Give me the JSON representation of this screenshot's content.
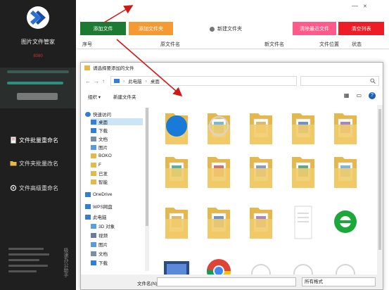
{
  "app": {
    "title": "图片文件管家",
    "subtitle": "8080"
  },
  "sidebar": {
    "items": [
      {
        "label": "文件批量重命名"
      },
      {
        "label": "文件夹批量改名"
      },
      {
        "label": "文件高级重命名"
      }
    ],
    "footer_text": "极速办公助手"
  },
  "window_controls": {
    "minimize": "—",
    "close": "✕"
  },
  "toolbar": {
    "add_file": "添加文件",
    "add_folder": "添加文件夹",
    "new_folder": "新建文件夹",
    "clear_recent": "清除最近文件",
    "clear_list": "清空列表",
    "accent_add": "#1d7a32",
    "accent_folder": "#f59a32",
    "accent_clear_recent": "#ff5a8a",
    "accent_clear": "#ee1c24"
  },
  "table": {
    "columns": [
      "序号",
      "原文件名",
      "新文件名",
      "文件位置",
      "状态"
    ]
  },
  "dialog": {
    "title": "请选择要添加的文件",
    "breadcrumb": [
      "此电脑",
      "桌面"
    ],
    "search_icon": "search-icon",
    "organize": "组织 ▾",
    "new_folder": "新建文件夹",
    "help": "?",
    "tree": [
      {
        "label": "快速访问",
        "icon": "star-icon"
      },
      {
        "label": "桌面",
        "icon": "desktop-icon",
        "selected": true
      },
      {
        "label": "下载",
        "icon": "download-icon"
      },
      {
        "label": "文档",
        "icon": "document-icon"
      },
      {
        "label": "图片",
        "icon": "picture-icon"
      },
      {
        "label": "BOKO",
        "icon": "folder-icon"
      },
      {
        "label": "F",
        "icon": "folder-icon"
      },
      {
        "label": "已发",
        "icon": "folder-icon"
      },
      {
        "label": "智能",
        "icon": "folder-icon"
      },
      {
        "label": "OneDrive",
        "icon": "cloud-icon"
      },
      {
        "label": "WPS网盘",
        "icon": "cloud-icon"
      },
      {
        "label": "此电脑",
        "icon": "computer-icon"
      },
      {
        "label": "3D 对象",
        "icon": "cube-icon"
      },
      {
        "label": "视频",
        "icon": "video-icon"
      },
      {
        "label": "图片",
        "icon": "picture-icon"
      },
      {
        "label": "文档",
        "icon": "document-icon"
      },
      {
        "label": "下载",
        "icon": "download-icon"
      }
    ],
    "files": [
      {
        "kind": "folder",
        "icon": "folder-icon"
      },
      {
        "kind": "folder",
        "icon": "folder-icon"
      },
      {
        "kind": "folder",
        "icon": "folder-icon"
      },
      {
        "kind": "folder",
        "icon": "folder-icon"
      },
      {
        "kind": "folder",
        "icon": "folder-icon"
      },
      {
        "kind": "folder",
        "icon": "folder-icon"
      },
      {
        "kind": "folder",
        "icon": "folder-icon"
      },
      {
        "kind": "folder",
        "icon": "folder-icon"
      },
      {
        "kind": "folder",
        "icon": "folder-icon"
      },
      {
        "kind": "folder",
        "icon": "folder-icon"
      },
      {
        "kind": "folder",
        "icon": "folder-icon"
      },
      {
        "kind": "folder",
        "icon": "folder-icon"
      },
      {
        "kind": "folder",
        "icon": "folder-icon"
      },
      {
        "kind": "document",
        "icon": "document-icon"
      },
      {
        "kind": "app",
        "icon": "ie-browser-icon"
      },
      {
        "kind": "app",
        "icon": "video-app-icon"
      },
      {
        "kind": "app",
        "icon": "chrome-icon"
      },
      {
        "kind": "blank",
        "icon": "blank-icon"
      },
      {
        "kind": "blank",
        "icon": "blank-icon"
      },
      {
        "kind": "blank",
        "icon": "blank-icon"
      },
      {
        "kind": "app",
        "icon": "blue-app-icon"
      },
      {
        "kind": "blank",
        "icon": "blank-icon"
      }
    ],
    "filename_label": "文件名(N):",
    "filename_value": "",
    "filter_value": "所有格式"
  }
}
